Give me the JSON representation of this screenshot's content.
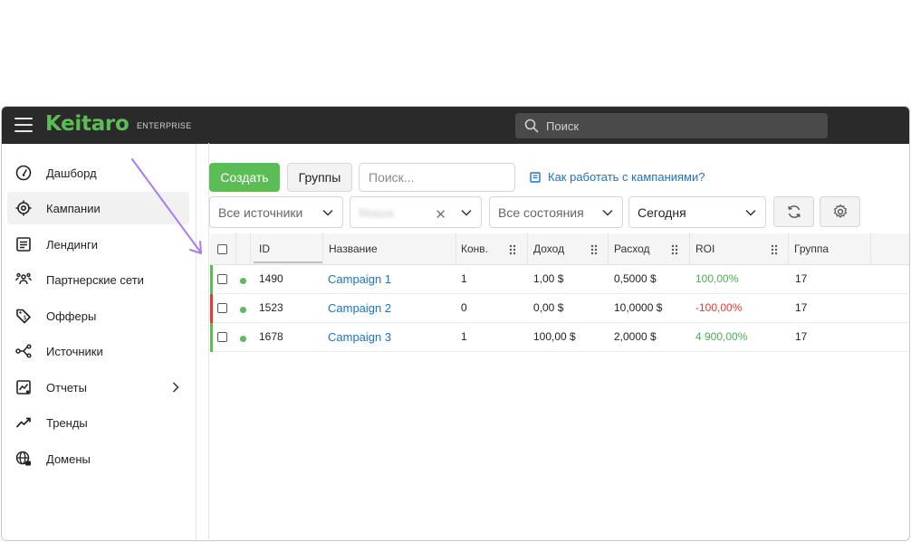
{
  "app": {
    "logo": "Keitaro",
    "edition": "ENTERPRISE",
    "search_placeholder": "Поиск"
  },
  "sidebar": {
    "items": [
      {
        "label": "Дашборд",
        "icon": "dashboard-gauge-icon"
      },
      {
        "label": "Кампании",
        "icon": "target-icon",
        "active": true
      },
      {
        "label": "Лендинги",
        "icon": "landing-page-icon"
      },
      {
        "label": "Партнерские сети",
        "icon": "network-users-icon"
      },
      {
        "label": "Офферы",
        "icon": "tag-icon"
      },
      {
        "label": "Источники",
        "icon": "source-branch-icon"
      },
      {
        "label": "Отчеты",
        "icon": "report-chart-icon",
        "has_submenu": true
      },
      {
        "label": "Тренды",
        "icon": "trend-line-icon"
      },
      {
        "label": "Домены",
        "icon": "globe-domain-icon"
      }
    ]
  },
  "toolbar": {
    "create_label": "Создать",
    "groups_label": "Группы",
    "search_placeholder": "Поиск...",
    "help_link": "Как работать с кампаниями?"
  },
  "filters": {
    "sources": "Все источники",
    "user": "Маша",
    "states": "Все состояния",
    "period": "Сегодня"
  },
  "table": {
    "columns": [
      "ID",
      "Название",
      "Конв.",
      "Доход",
      "Расход",
      "ROI",
      "Группа"
    ],
    "rows": [
      {
        "status_color": "#5bbd55",
        "id": "1490",
        "name": "Campaign 1",
        "conv": "1",
        "revenue": "1,00 $",
        "cost": "0,5000 $",
        "roi": "100,00%",
        "roi_sign": "pos",
        "group": "17"
      },
      {
        "status_color": "#e53935",
        "id": "1523",
        "name": "Campaign 2",
        "conv": "0",
        "revenue": "0,00 $",
        "cost": "10,0000 $",
        "roi": "-100,00%",
        "roi_sign": "neg",
        "group": "17"
      },
      {
        "status_color": "#5bbd55",
        "id": "1678",
        "name": "Campaign 3",
        "conv": "1",
        "revenue": "100,00 $",
        "cost": "2,0000 $",
        "roi": "4 900,00%",
        "roi_sign": "pos",
        "group": "17"
      }
    ]
  },
  "colors": {
    "brand": "#5bbd55",
    "link": "#1a73c8",
    "negative": "#e53935",
    "annotation_arrow": "#a97cf0"
  }
}
